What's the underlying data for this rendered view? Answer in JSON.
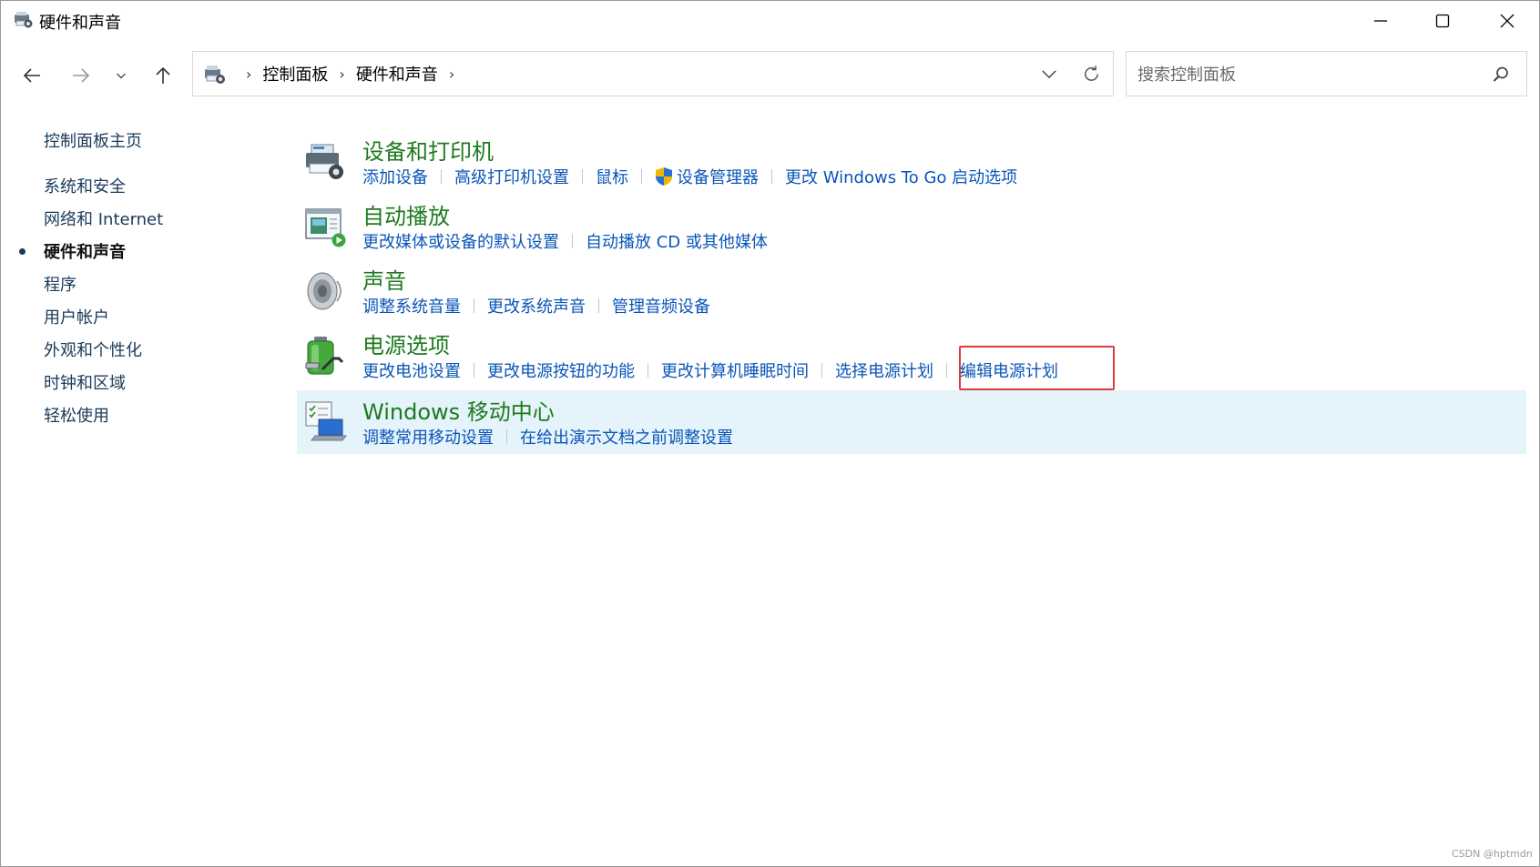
{
  "window": {
    "title": "硬件和声音"
  },
  "address": {
    "crumbs": [
      "控制面板",
      "硬件和声音"
    ]
  },
  "search": {
    "placeholder": "搜索控制面板"
  },
  "sidebar": {
    "items": [
      {
        "label": "控制面板主页",
        "active": false
      },
      {
        "label": "系统和安全",
        "active": false
      },
      {
        "label": "网络和 Internet",
        "active": false
      },
      {
        "label": "硬件和声音",
        "active": true
      },
      {
        "label": "程序",
        "active": false
      },
      {
        "label": "用户帐户",
        "active": false
      },
      {
        "label": "外观和个性化",
        "active": false
      },
      {
        "label": "时钟和区域",
        "active": false
      },
      {
        "label": "轻松使用",
        "active": false
      }
    ]
  },
  "categories": [
    {
      "title": "设备和打印机",
      "icon": "printer-icon",
      "links": [
        "添加设备",
        "高级打印机设置",
        "鼠标",
        "设备管理器",
        "更改 Windows To Go 启动选项"
      ]
    },
    {
      "title": "自动播放",
      "icon": "autoplay-icon",
      "links": [
        "更改媒体或设备的默认设置",
        "自动播放 CD 或其他媒体"
      ]
    },
    {
      "title": "声音",
      "icon": "speaker-icon",
      "links": [
        "调整系统音量",
        "更改系统声音",
        "管理音频设备"
      ]
    },
    {
      "title": "电源选项",
      "icon": "battery-icon",
      "links": [
        "更改电池设置",
        "更改电源按钮的功能",
        "更改计算机睡眠时间",
        "选择电源计划",
        "编辑电源计划"
      ]
    },
    {
      "title": "Windows 移动中心",
      "icon": "mobility-center-icon",
      "links": [
        "调整常用移动设置",
        "在给出演示文档之前调整设置"
      ]
    }
  ],
  "colors": {
    "category_title": "#1e7a1e",
    "link": "#0a55b8",
    "highlight_row": "#e5f3fb",
    "annotation_box": "#e0393e"
  },
  "watermark": "CSDN @hptmdn"
}
